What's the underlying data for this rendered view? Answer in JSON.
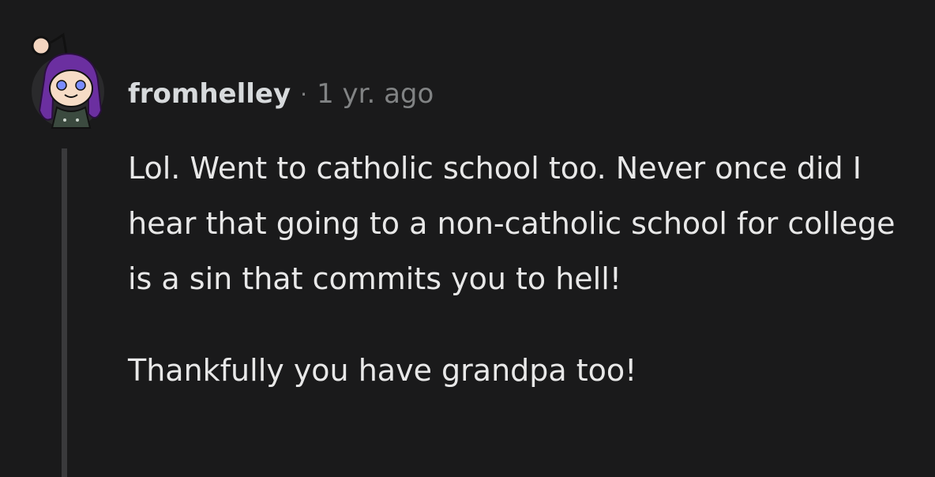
{
  "comment": {
    "username": "fromhelley",
    "separator": "·",
    "timestamp": "1 yr. ago",
    "paragraphs": [
      "Lol. Went to catholic school too. Never once did I hear that going to a non-catholic school for college is a sin that commits you to hell!",
      "Thankfully you have grandpa too!"
    ]
  },
  "colors": {
    "background": "#1a1a1b",
    "text": "#d7dadc",
    "muted": "#818384",
    "thread_line": "#3a3a3c",
    "avatar_hair": "#6b2fa0"
  },
  "icons": {
    "avatar": "snoo-avatar-icon"
  }
}
